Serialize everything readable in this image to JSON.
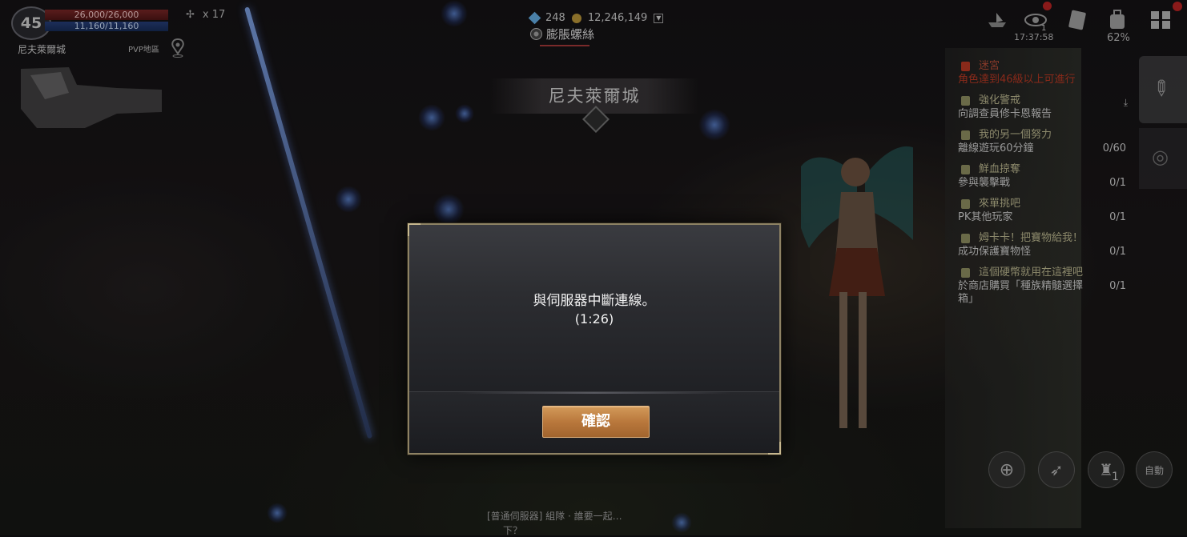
{
  "hud": {
    "level": "45",
    "hp": "26,000/26,000",
    "mp": "11,160/11,160",
    "count_label": "x 17",
    "zone_name": "尼夫萊爾城",
    "pvp_label": "PVP地區"
  },
  "currency": {
    "diamonds": "248",
    "gold": "12,246,149"
  },
  "buff": {
    "label": "膨脹螺絲"
  },
  "location_banner": "尼夫萊爾城",
  "top_right": {
    "notice_count": "1",
    "time": "17:37:58",
    "battery": "62%",
    "notif_badge": "1"
  },
  "quests": [
    {
      "title": "迷宮",
      "desc": "角色達到46級以上可進行",
      "progress": "",
      "locked": true
    },
    {
      "title": "強化警戒",
      "desc": "向調查員修卡恩報告",
      "progress": "",
      "locked": false,
      "download": true
    },
    {
      "title": "我的另一個努力",
      "desc": "離線遊玩60分鐘",
      "progress": "0/60",
      "locked": false
    },
    {
      "title": "鮮血掠奪",
      "desc": "參與襲擊戰",
      "progress": "0/1",
      "locked": false
    },
    {
      "title": "來單挑吧",
      "desc": "PK其他玩家",
      "progress": "0/1",
      "locked": false
    },
    {
      "title": "姆卡卡！把寶物給我！",
      "desc": "成功保護寶物怪",
      "progress": "0/1",
      "locked": false
    },
    {
      "title": "這個硬幣就用在這裡吧",
      "desc": "於商店購買「種族精髓選擇箱」",
      "progress": "0/1",
      "locked": false
    }
  ],
  "bottom_controls": {
    "skill_count": "1",
    "auto_label": "自動"
  },
  "chat": {
    "line1": "[普通伺服器] 組隊 · 誰要一起…",
    "line2": "下？"
  },
  "dialog": {
    "message": "與伺服器中斷連線。",
    "code": "(1:26)",
    "confirm_label": "確認"
  },
  "colors": {
    "confirm_button": "#b9783c",
    "dialog_border": "#8e8264",
    "quest_title": "#8d8a6c",
    "locked_quest": "#8a2a1a"
  }
}
